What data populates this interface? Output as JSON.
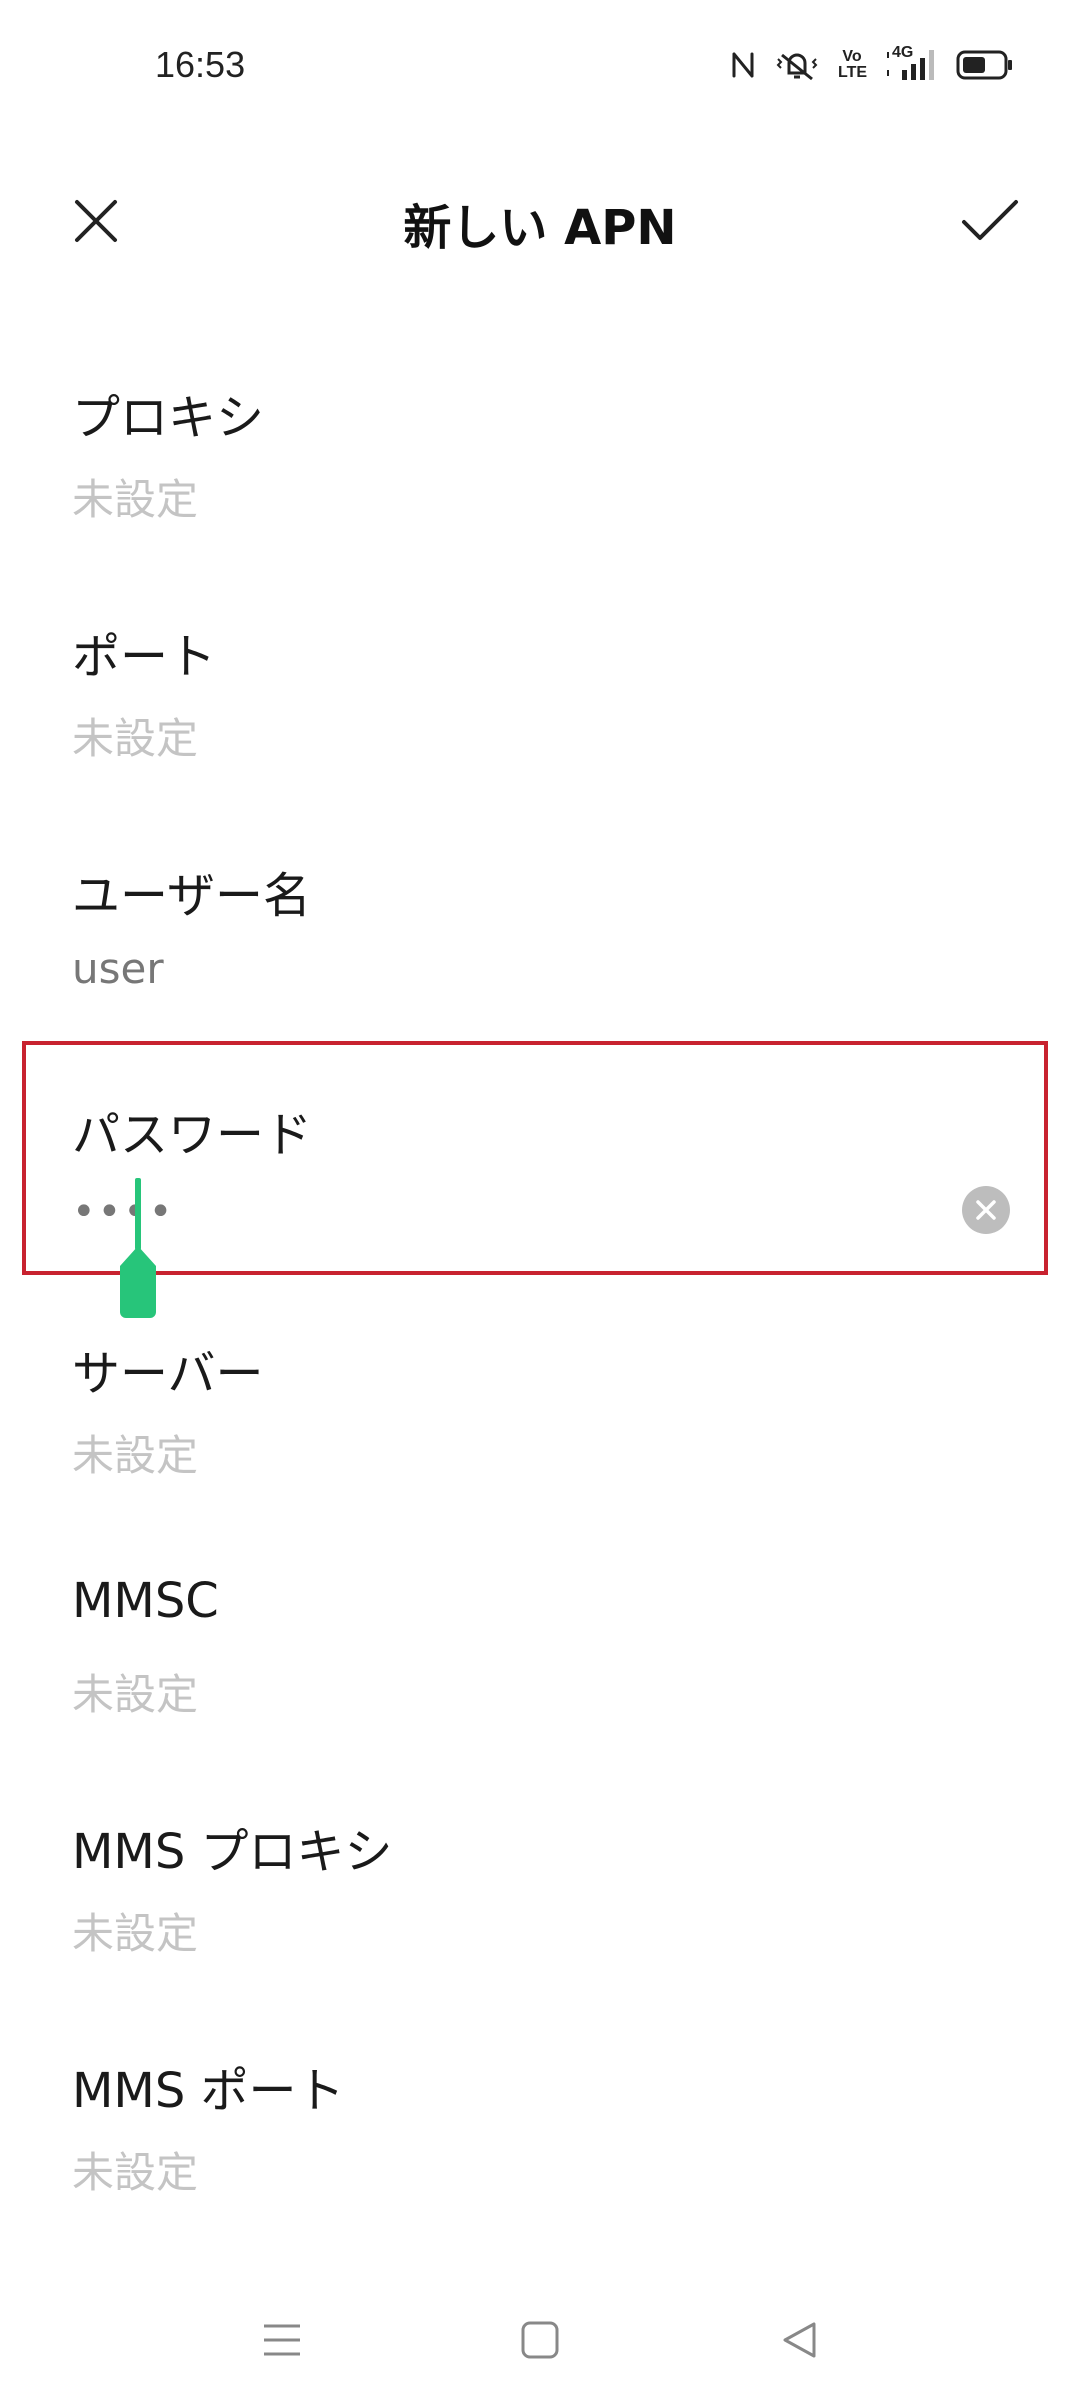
{
  "status_bar": {
    "time": "16:53",
    "icons": [
      "nfc-icon",
      "vibrate-icon",
      "volte-icon",
      "signal-4g-icon",
      "battery-icon"
    ],
    "volte_text_top": "Vo",
    "volte_text_bottom": "LTE",
    "network_label": "4G"
  },
  "app_bar": {
    "title": "新しい APN",
    "close_icon": "close-icon",
    "confirm_icon": "check-icon"
  },
  "fields": [
    {
      "label": "プロキシ",
      "value": "未設定",
      "state": "unset"
    },
    {
      "label": "ポート",
      "value": "未設定",
      "state": "unset"
    },
    {
      "label": "ユーザー名",
      "value": "user",
      "state": "filled"
    },
    {
      "label": "パスワード",
      "value": "••••",
      "state": "editing"
    },
    {
      "label": "サーバー",
      "value": "未設定",
      "state": "unset"
    },
    {
      "label": "MMSC",
      "value": "未設定",
      "state": "unset"
    },
    {
      "label": "MMS プロキシ",
      "value": "未設定",
      "state": "unset"
    },
    {
      "label": "MMS ポート",
      "value": "未設定",
      "state": "unset"
    }
  ],
  "colors": {
    "highlight_border": "#c8222f",
    "cursor": "#27c57a",
    "placeholder_text": "#c4c4c4",
    "filled_text": "#777777"
  },
  "nav_bar": {
    "buttons": [
      "menu-icon",
      "home-icon",
      "back-icon"
    ]
  }
}
